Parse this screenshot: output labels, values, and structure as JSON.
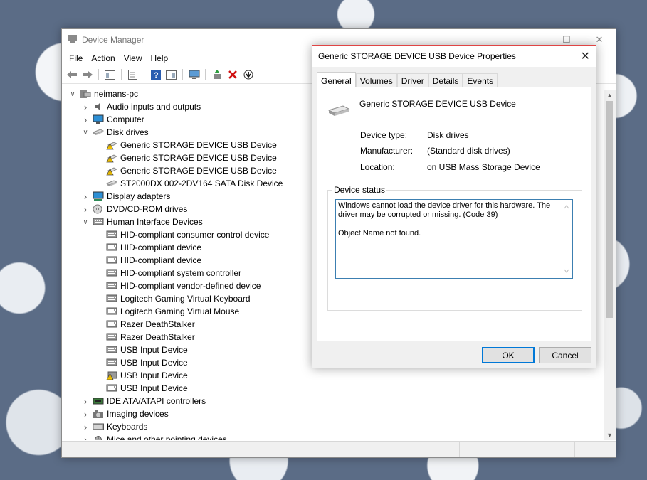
{
  "device_manager": {
    "title": "Device Manager",
    "menu": [
      "File",
      "Action",
      "View",
      "Help"
    ],
    "tree": [
      {
        "label": "neimans-pc",
        "level": 0,
        "expander": "open",
        "icon": "computer-icon"
      },
      {
        "label": "Audio inputs and outputs",
        "level": 1,
        "expander": "closed",
        "icon": "speaker-icon"
      },
      {
        "label": "Computer",
        "level": 1,
        "expander": "closed",
        "icon": "monitor-icon"
      },
      {
        "label": "Disk drives",
        "level": 1,
        "expander": "open",
        "icon": "disk-drive-icon"
      },
      {
        "label": "Generic STORAGE DEVICE USB Device",
        "level": 2,
        "expander": "none",
        "icon": "warning-disk-icon"
      },
      {
        "label": "Generic STORAGE DEVICE USB Device",
        "level": 2,
        "expander": "none",
        "icon": "warning-disk-icon"
      },
      {
        "label": "Generic STORAGE DEVICE USB Device",
        "level": 2,
        "expander": "none",
        "icon": "warning-disk-icon"
      },
      {
        "label": "ST2000DX 002-2DV164 SATA Disk Device",
        "level": 2,
        "expander": "none",
        "icon": "disk-drive-icon"
      },
      {
        "label": "Display adapters",
        "level": 1,
        "expander": "closed",
        "icon": "display-adapter-icon"
      },
      {
        "label": "DVD/CD-ROM drives",
        "level": 1,
        "expander": "closed",
        "icon": "dvd-icon"
      },
      {
        "label": "Human Interface Devices",
        "level": 1,
        "expander": "open",
        "icon": "hid-icon"
      },
      {
        "label": "HID-compliant consumer control device",
        "level": 2,
        "expander": "none",
        "icon": "hid-icon"
      },
      {
        "label": "HID-compliant device",
        "level": 2,
        "expander": "none",
        "icon": "hid-icon"
      },
      {
        "label": "HID-compliant device",
        "level": 2,
        "expander": "none",
        "icon": "hid-icon"
      },
      {
        "label": "HID-compliant system controller",
        "level": 2,
        "expander": "none",
        "icon": "hid-icon"
      },
      {
        "label": "HID-compliant vendor-defined device",
        "level": 2,
        "expander": "none",
        "icon": "hid-icon"
      },
      {
        "label": "Logitech Gaming Virtual Keyboard",
        "level": 2,
        "expander": "none",
        "icon": "hid-icon"
      },
      {
        "label": "Logitech Gaming Virtual Mouse",
        "level": 2,
        "expander": "none",
        "icon": "hid-icon"
      },
      {
        "label": "Razer DeathStalker",
        "level": 2,
        "expander": "none",
        "icon": "hid-icon"
      },
      {
        "label": "Razer DeathStalker",
        "level": 2,
        "expander": "none",
        "icon": "hid-icon"
      },
      {
        "label": "USB Input Device",
        "level": 2,
        "expander": "none",
        "icon": "hid-icon"
      },
      {
        "label": "USB Input Device",
        "level": 2,
        "expander": "none",
        "icon": "hid-icon"
      },
      {
        "label": "USB Input Device",
        "level": 2,
        "expander": "none",
        "icon": "warning-hid-icon"
      },
      {
        "label": "USB Input Device",
        "level": 2,
        "expander": "none",
        "icon": "hid-icon"
      },
      {
        "label": "IDE ATA/ATAPI controllers",
        "level": 1,
        "expander": "closed",
        "icon": "controller-icon"
      },
      {
        "label": "Imaging devices",
        "level": 1,
        "expander": "closed",
        "icon": "camera-icon"
      },
      {
        "label": "Keyboards",
        "level": 1,
        "expander": "closed",
        "icon": "keyboard-icon"
      },
      {
        "label": "Mice and other pointing devices",
        "level": 1,
        "expander": "closed",
        "icon": "mouse-icon"
      }
    ]
  },
  "properties_dialog": {
    "title": "Generic STORAGE DEVICE USB Device Properties",
    "tabs": [
      "General",
      "Volumes",
      "Driver",
      "Details",
      "Events"
    ],
    "active_tab": "General",
    "device_name": "Generic STORAGE DEVICE USB Device",
    "device_type_label": "Device type:",
    "device_type_value": "Disk drives",
    "manufacturer_label": "Manufacturer:",
    "manufacturer_value": "(Standard disk drives)",
    "location_label": "Location:",
    "location_value": "on USB Mass Storage Device",
    "status_group_label": "Device status",
    "status_text_1": "Windows cannot load the device driver for this hardware. The driver may be corrupted or missing. (Code 39)",
    "status_text_2": "Object Name not found.",
    "ok_label": "OK",
    "cancel_label": "Cancel"
  },
  "colors": {
    "accent": "#0078d7",
    "dialog_border": "#e04545",
    "warning": "#f5c400"
  }
}
